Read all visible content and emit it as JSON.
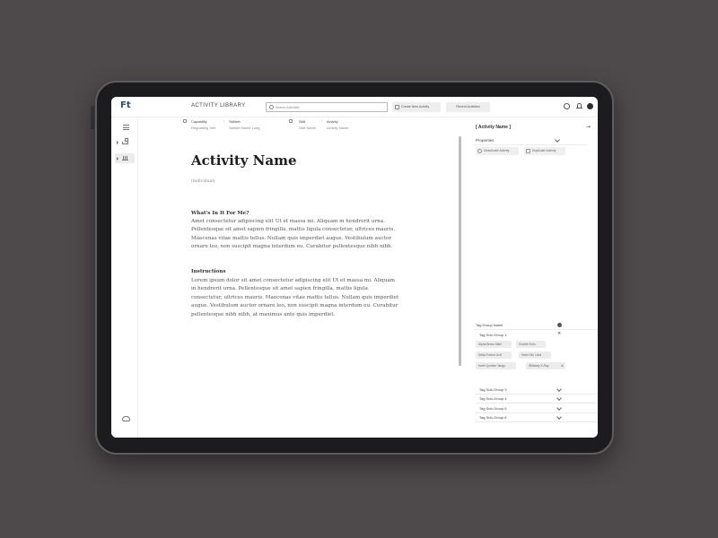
{
  "topbar": {
    "logo": "Ft",
    "title": "ACTIVITY LIBRARY",
    "search_placeholder": "Search Activities",
    "create_label": "Create New Activity",
    "recent_label": "Recent Activities"
  },
  "breadcrumb": [
    {
      "key": "Capability",
      "value": "Regulating Self"
    },
    {
      "key": "Skillset",
      "value": "Skillset Name Long"
    },
    {
      "key": "Skill",
      "value": "Skill Name"
    },
    {
      "key": "Activity",
      "value": "Activity Name"
    }
  ],
  "document": {
    "title": "Activity Name",
    "subtitle": "(individual)",
    "sections": [
      {
        "heading": "What's In It For Me?",
        "body": "Amet consectetur adipiscing elit Ut et massa mi. Aliquam in hendrerit urna. Pellentesque sit amet sapien fringilla, mattis ligula consectetur, ultrices mauris. Maecenas vitae mattis tellus. Nullam quis imperdiet augue. Vestibulum auctor ornare leo, non suscipit magna interdum eu. Curabitur pellentesque nibh nibh."
      },
      {
        "heading": "Instructions",
        "body": "Lorem ipsum dolor sit amet consectetur adipiscing elit Ut et massa mi. Aliquam in hendrerit urna. Pellentesque sit amet sapien fringilla, mattis ligula consectetur, ultrices mauris. Maecenas vitae mattis tellus. Nullam quis imperdiet augue. Vestibulum auctor ornare leo, non suscipit magna interdum eu. Curabitur pellentesque nibh nibh, at maximus ante quis imperdiet."
      }
    ]
  },
  "panel": {
    "header": "[ Activity Name ]",
    "close_glyph": "→",
    "properties_label": "Properties",
    "deactivate_label": "Deactivate Activity",
    "duplicate_label": "Duplicate Activity",
    "tag_group_name": "Tag Group Name",
    "subgroup1": {
      "name": "Tag Sub-Group 1",
      "close_glyph": "×",
      "tags": [
        "Alpha Bravo Miler",
        "Charlie Echo",
        "Delta Foxtrot Golf",
        "Hotel Kilo Lima",
        "Hotel Quebec Tango",
        "Whiskey X-Ray"
      ]
    },
    "subgroups": [
      "Tag Sub-Group 3",
      "Tag Sub-Group 4",
      "Tag Sub-Group 5",
      "Tag Sub-Group 6"
    ]
  }
}
